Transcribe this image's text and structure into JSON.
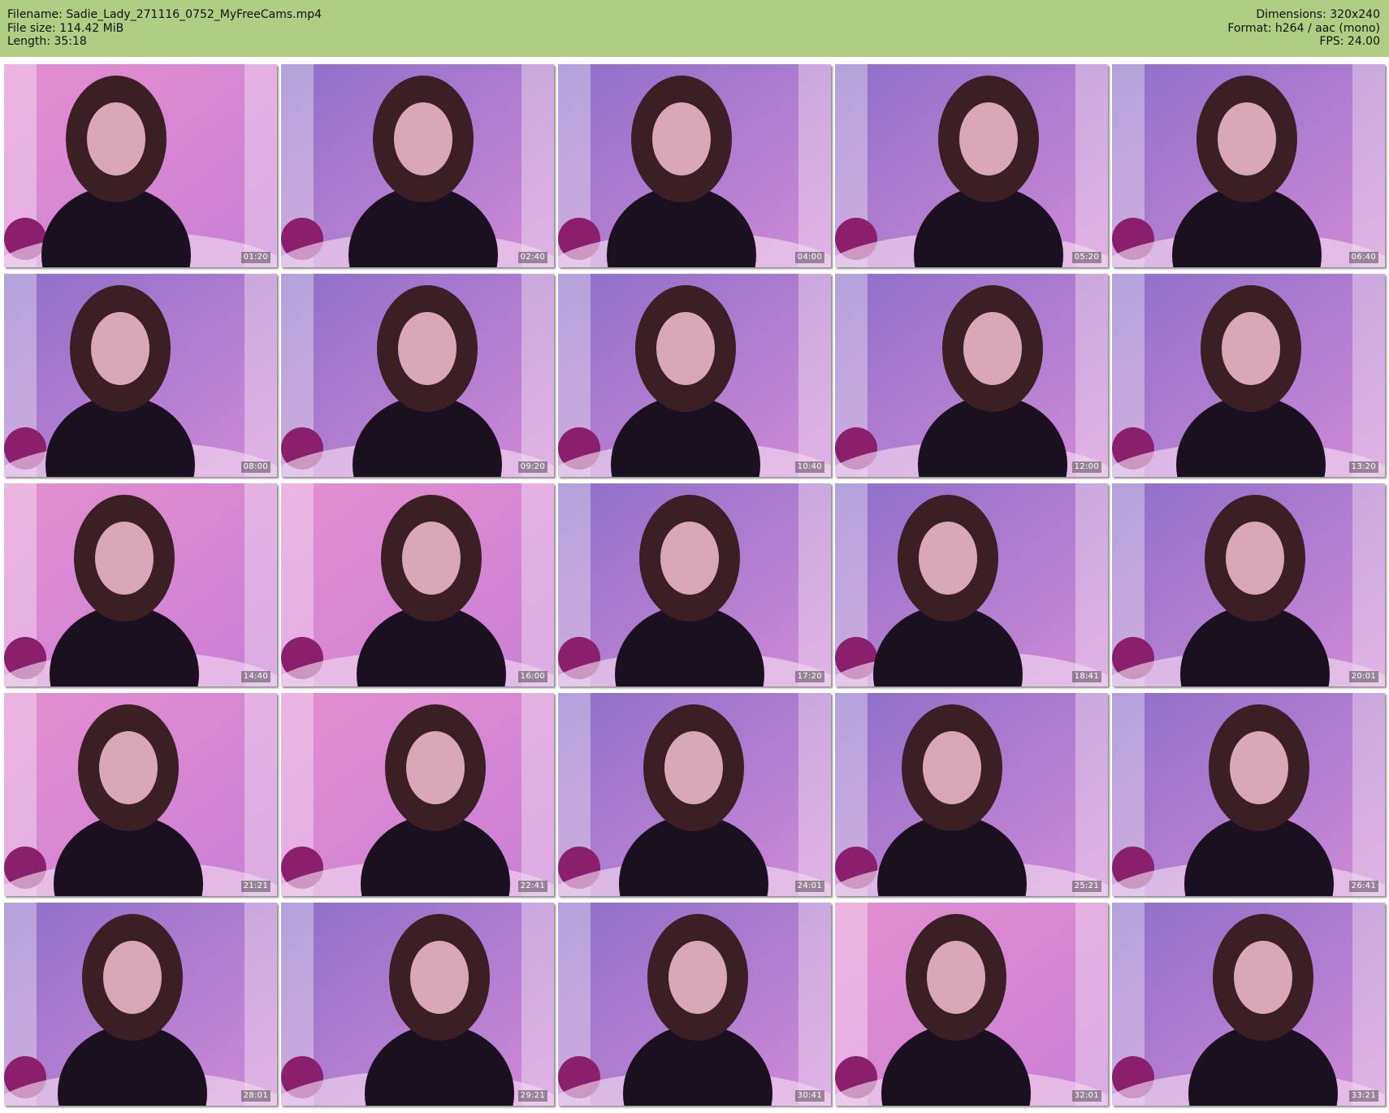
{
  "info": {
    "filename_label": "Filename:",
    "filename": "Sadie_Lady_271116_0752_MyFreeCams.mp4",
    "filesize_label": "File size:",
    "filesize": "114.42 MiB",
    "length_label": "Length:",
    "length": "35:18",
    "dimensions_label": "Dimensions:",
    "dimensions": "320x240",
    "format_label": "Format:",
    "format": "h264 / aac (mono)",
    "fps_label": "FPS:",
    "fps": "24.00"
  },
  "colors": {
    "header_bg": "#afcd83",
    "wall_pink": "#e48ed0",
    "wall_purple": "#8c6fc9",
    "sweater": "#1a1020",
    "hair": "#3a2024",
    "skin": "#d9a7b8"
  },
  "thumbnails": [
    {
      "time": "01:20",
      "tone": "pink"
    },
    {
      "time": "02:40",
      "tone": "purple"
    },
    {
      "time": "04:00",
      "tone": "purple"
    },
    {
      "time": "05:20",
      "tone": "purple"
    },
    {
      "time": "06:40",
      "tone": "purple"
    },
    {
      "time": "08:00",
      "tone": "purple"
    },
    {
      "time": "09:20",
      "tone": "purple"
    },
    {
      "time": "10:40",
      "tone": "purple"
    },
    {
      "time": "12:00",
      "tone": "purple"
    },
    {
      "time": "13:20",
      "tone": "purple"
    },
    {
      "time": "14:40",
      "tone": "pink"
    },
    {
      "time": "16:00",
      "tone": "pink"
    },
    {
      "time": "17:20",
      "tone": "purple"
    },
    {
      "time": "18:41",
      "tone": "purple"
    },
    {
      "time": "20:01",
      "tone": "purple"
    },
    {
      "time": "21:21",
      "tone": "pink"
    },
    {
      "time": "22:41",
      "tone": "pink"
    },
    {
      "time": "24:01",
      "tone": "purple"
    },
    {
      "time": "25:21",
      "tone": "purple"
    },
    {
      "time": "26:41",
      "tone": "purple"
    },
    {
      "time": "28:01",
      "tone": "purple"
    },
    {
      "time": "29:21",
      "tone": "purple"
    },
    {
      "time": "30:41",
      "tone": "purple"
    },
    {
      "time": "32:01",
      "tone": "pink"
    },
    {
      "time": "33:21",
      "tone": "purple"
    }
  ]
}
